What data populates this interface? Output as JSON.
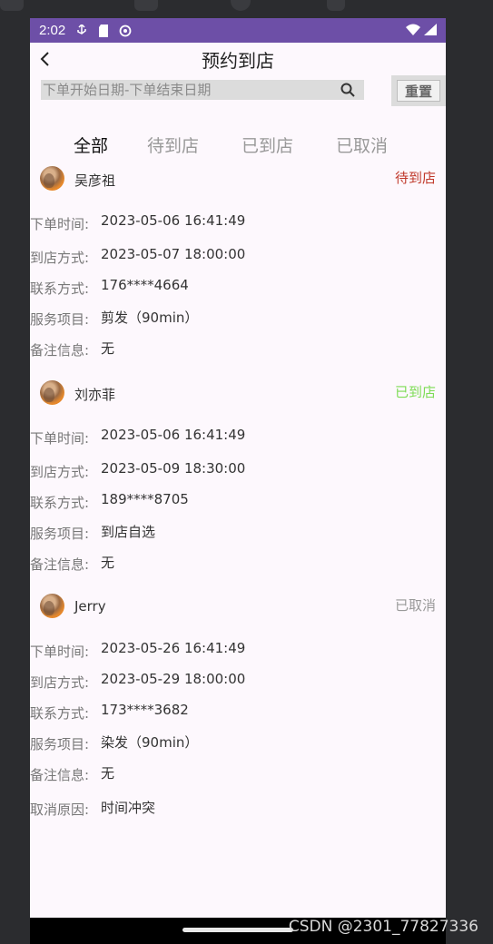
{
  "statusbar": {
    "time": "2:02"
  },
  "header": {
    "title": "预约到店"
  },
  "search": {
    "placeholder": "下单开始日期-下单结束日期",
    "reset_label": "重置"
  },
  "tabs": [
    {
      "label": "全部",
      "active": true
    },
    {
      "label": "待到店",
      "active": false
    },
    {
      "label": "已到店",
      "active": false
    },
    {
      "label": "已取消",
      "active": false
    }
  ],
  "colors": {
    "statusbar": "#6d4fa7",
    "pending": "#c0392b",
    "arrived": "#7ddc55",
    "cancelled": "#999999"
  },
  "orders": [
    {
      "name": "吴彦祖",
      "status": "待到店",
      "rows": [
        {
          "label": "下单时间:",
          "value": "2023-05-06 16:41:49"
        },
        {
          "label": "到店方式:",
          "value": "2023-05-07 18:00:00"
        },
        {
          "label": "联系方式:",
          "value": "176****4664"
        },
        {
          "label": "服务项目:",
          "value": "剪发（90min）"
        },
        {
          "label": "备注信息:",
          "value": "无"
        }
      ]
    },
    {
      "name": "刘亦菲",
      "status": "已到店",
      "rows": [
        {
          "label": "下单时间:",
          "value": "2023-05-06 16:41:49"
        },
        {
          "label": "到店方式:",
          "value": "2023-05-09 18:30:00"
        },
        {
          "label": "联系方式:",
          "value": "189****8705"
        },
        {
          "label": "服务项目:",
          "value": "到店自选"
        },
        {
          "label": "备注信息:",
          "value": "无"
        }
      ]
    },
    {
      "name": "Jerry",
      "status": "已取消",
      "rows": [
        {
          "label": "下单时间:",
          "value": "2023-05-26 16:41:49"
        },
        {
          "label": "到店方式:",
          "value": "2023-05-29 18:00:00"
        },
        {
          "label": "联系方式:",
          "value": "173****3682"
        },
        {
          "label": "服务项目:",
          "value": "染发（90min）"
        },
        {
          "label": "备注信息:",
          "value": "无"
        },
        {
          "label": "取消原因:",
          "value": "时间冲突"
        }
      ]
    }
  ],
  "watermark": "CSDN @2301_77827336"
}
